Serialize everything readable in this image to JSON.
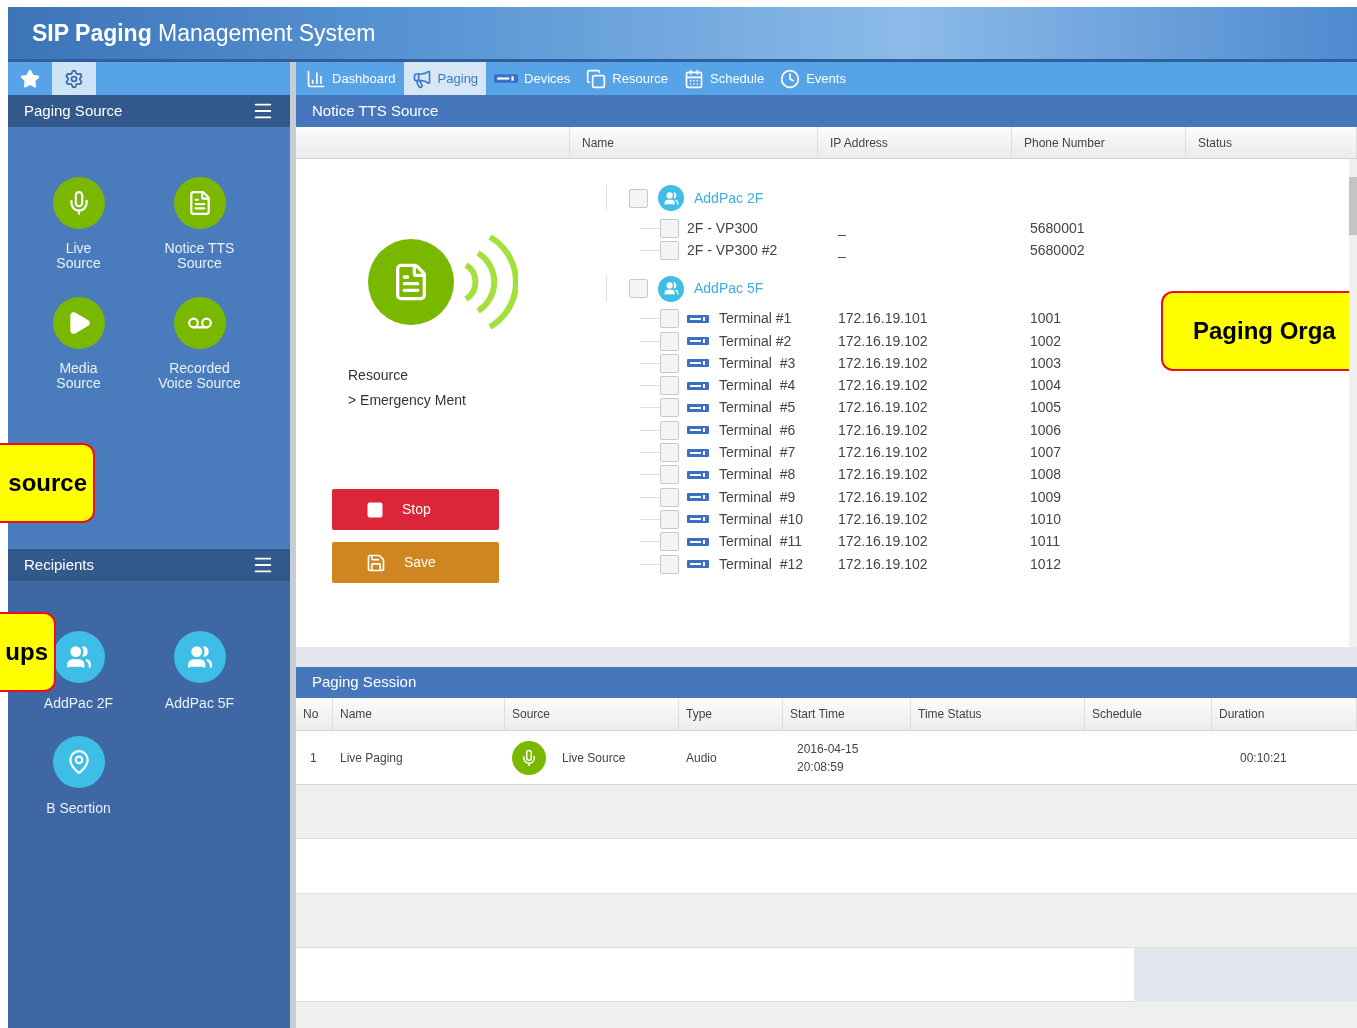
{
  "window": {
    "title": "**SIP Paging** Management System"
  },
  "sidebar_toolbar": [
    {
      "kind": "star",
      "selected": false
    },
    {
      "kind": "gear",
      "selected": true
    }
  ],
  "nav_tabs": [
    {
      "label": "Dashboard",
      "kind": "chart",
      "selected": false
    },
    {
      "label": "Paging",
      "kind": "megaphone",
      "selected": true
    },
    {
      "label": "Devices",
      "kind": "device",
      "selected": false
    },
    {
      "label": "Resource",
      "kind": "copy",
      "selected": false
    },
    {
      "label": "Schedule",
      "kind": "calendar",
      "selected": false
    },
    {
      "label": "Events",
      "kind": "clock",
      "selected": false
    }
  ],
  "paging_source": {
    "title": "Paging Source",
    "items": [
      {
        "label": "Live\nSource",
        "kind": "mic"
      },
      {
        "label": "Notice TTS\nSource",
        "kind": "tts"
      },
      {
        "label": "Media\nSource",
        "kind": "play"
      },
      {
        "label": "Recorded\nVoice Source",
        "kind": "voicemail"
      }
    ]
  },
  "recipients": {
    "title": "Recipients",
    "items": [
      {
        "label": "AddPac 2F",
        "kind": "group"
      },
      {
        "label": "AddPac 5F",
        "kind": "group"
      },
      {
        "label": "B Secrtion",
        "kind": "location"
      }
    ]
  },
  "source_panel": {
    "title": "Notice TTS Source",
    "columns": [
      "Name",
      "IP Address",
      "Phone Number",
      "Status"
    ],
    "resource_label": "Resource",
    "resource_path": "> Emergency Ment",
    "buttons": [
      {
        "label": "Stop",
        "kind": "stop"
      },
      {
        "label": "Save",
        "kind": "save"
      }
    ],
    "tree": [
      {
        "name": "AddPac 2F",
        "checked": false,
        "children": [
          {
            "name": "2F - VP300",
            "kind": "plain",
            "ip": "_",
            "phone": "5680001",
            "checked": false
          },
          {
            "name": "2F - VP300 #2",
            "kind": "plain",
            "ip": "_",
            "phone": "5680002",
            "checked": false
          }
        ]
      },
      {
        "name": "AddPac 5F",
        "checked": false,
        "children": [
          {
            "name": "Terminal #1",
            "kind": "terminal",
            "ip": "172.16.19.101",
            "phone": "1001",
            "checked": false
          },
          {
            "name": "Terminal #2",
            "kind": "terminal",
            "ip": "172.16.19.102",
            "phone": "1002",
            "checked": false
          },
          {
            "name": "Terminal  #3",
            "kind": "terminal",
            "ip": "172.16.19.102",
            "phone": "1003",
            "checked": false
          },
          {
            "name": "Terminal  #4",
            "kind": "terminal",
            "ip": "172.16.19.102",
            "phone": "1004",
            "checked": false
          },
          {
            "name": "Terminal  #5",
            "kind": "terminal",
            "ip": "172.16.19.102",
            "phone": "1005",
            "checked": false
          },
          {
            "name": "Terminal  #6",
            "kind": "terminal",
            "ip": "172.16.19.102",
            "phone": "1006",
            "checked": false
          },
          {
            "name": "Terminal  #7",
            "kind": "terminal",
            "ip": "172.16.19.102",
            "phone": "1007",
            "checked": false
          },
          {
            "name": "Terminal  #8",
            "kind": "terminal",
            "ip": "172.16.19.102",
            "phone": "1008",
            "checked": false
          },
          {
            "name": "Terminal  #9",
            "kind": "terminal",
            "ip": "172.16.19.102",
            "phone": "1009",
            "checked": false
          },
          {
            "name": "Terminal  #10",
            "kind": "terminal",
            "ip": "172.16.19.102",
            "phone": "1010",
            "checked": false
          },
          {
            "name": "Terminal  #11",
            "kind": "terminal",
            "ip": "172.16.19.102",
            "phone": "1011",
            "checked": false
          },
          {
            "name": "Terminal  #12",
            "kind": "terminal",
            "ip": "172.16.19.102",
            "phone": "1012",
            "checked": false
          }
        ]
      }
    ]
  },
  "paging_session": {
    "title": "Paging Session",
    "columns": [
      "No",
      "Name",
      "Source",
      "Type",
      "Start Time",
      "Time Status",
      "Schedule",
      "Duration"
    ],
    "rows": [
      {
        "no": "1",
        "name": "Live Paging",
        "source": "Live Source",
        "type": "Audio",
        "start_date": "2016-04-15",
        "start_time": "20:08:59",
        "duration": "00:10:21"
      }
    ]
  },
  "callouts": [
    {
      "text": "source",
      "kind": "left"
    },
    {
      "text": "ups",
      "kind": "left"
    },
    {
      "text": "Paging Orga",
      "kind": "right"
    }
  ]
}
